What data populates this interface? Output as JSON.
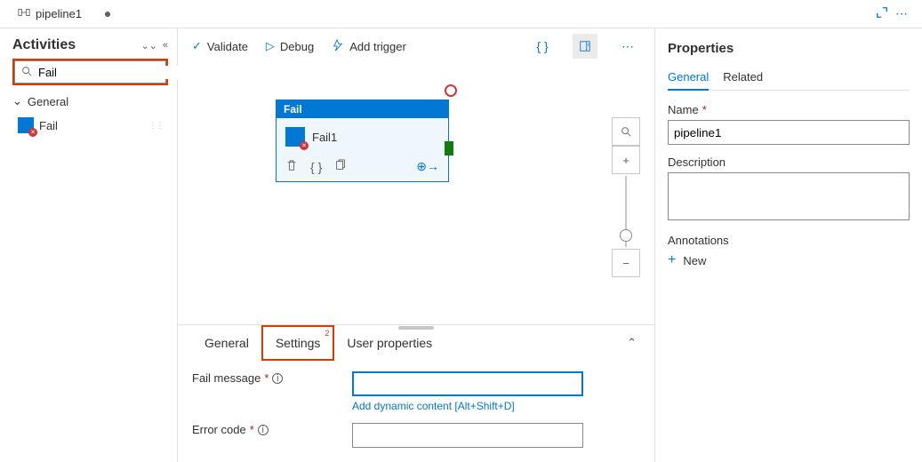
{
  "tab": {
    "title": "pipeline1"
  },
  "sidebar": {
    "title": "Activities",
    "search_value": "Fail",
    "category": "General",
    "activity": "Fail"
  },
  "toolbar": {
    "validate": "Validate",
    "debug": "Debug",
    "add_trigger": "Add trigger"
  },
  "node": {
    "type": "Fail",
    "name": "Fail1"
  },
  "bottom": {
    "tabs": {
      "general": "General",
      "settings": "Settings",
      "user_props": "User properties",
      "settings_badge": "2"
    },
    "fail_message_label": "Fail message",
    "fail_message_value": "",
    "dyn_link": "Add dynamic content [Alt+Shift+D]",
    "error_code_label": "Error code",
    "error_code_value": ""
  },
  "props": {
    "title": "Properties",
    "tabs": {
      "general": "General",
      "related": "Related"
    },
    "name_label": "Name",
    "name_value": "pipeline1",
    "desc_label": "Description",
    "desc_value": "",
    "ann_label": "Annotations",
    "new_label": "New"
  }
}
